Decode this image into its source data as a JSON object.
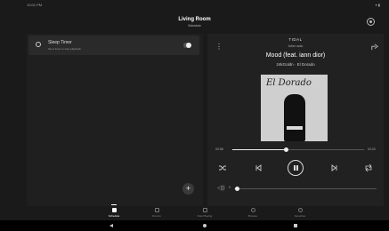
{
  "status_bar": {
    "time": "12:01 PM",
    "system": "▾ ▮"
  },
  "header": {
    "title": "Living Room",
    "subtitle": "Schedule",
    "settings_icon": "gear-icon"
  },
  "sleep_timer": {
    "title": "Sleep Timer",
    "subtitle": "Set a timer to stop playback",
    "enabled": true
  },
  "fab": {
    "label": "+"
  },
  "now_playing": {
    "service": "TIDAL",
    "source": "Artist radio",
    "song": "Mood (feat. iann dior)",
    "artist_album": "24kGoldn · El Dorado",
    "album_art_text": "El Dorado",
    "album_badge": "24KGOLDN",
    "elapsed": "00:58",
    "duration": "02:20",
    "progress": 0.41,
    "volume": 0.02,
    "volume_label": "0"
  },
  "bottom_nav": [
    {
      "label": "Schedule",
      "icon": "calendar-icon",
      "active": true
    },
    {
      "label": "Rooms",
      "icon": "rooms-icon",
      "active": false
    },
    {
      "label": "Now Playing",
      "icon": "music-note-icon",
      "active": false
    },
    {
      "label": "Browse",
      "icon": "search-icon",
      "active": false
    },
    {
      "label": "Favorites",
      "icon": "star-icon",
      "active": false
    }
  ]
}
